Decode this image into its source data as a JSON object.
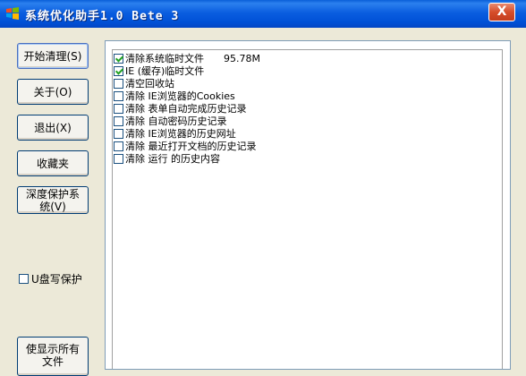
{
  "window": {
    "title": "系统优化助手1.0 Bete 3",
    "close_label": "X",
    "accent": "#0054e3"
  },
  "sidebar": {
    "buttons": [
      {
        "label": "开始清理(S)"
      },
      {
        "label": "关于(O)"
      },
      {
        "label": "退出(X)"
      },
      {
        "label": "收藏夹"
      },
      {
        "label": "深度保护系统(V)"
      },
      {
        "label": "使显示所有文件"
      }
    ],
    "vdisk": {
      "label": "U盘写保护",
      "checked": false
    }
  },
  "list": {
    "items": [
      {
        "label": "清除系统临时文件",
        "checked": true,
        "size": "95.78M"
      },
      {
        "label": "IE (缓存)临时文件",
        "checked": true
      },
      {
        "label": "清空回收站",
        "checked": false
      },
      {
        "label": "清除 IE浏览器的Cookies",
        "checked": false
      },
      {
        "label": "清除 表单自动完成历史记录",
        "checked": false
      },
      {
        "label": "清除 自动密码历史记录",
        "checked": false
      },
      {
        "label": "清除 IE浏览器的历史网址",
        "checked": false
      },
      {
        "label": "清除 最近打开文档的历史记录",
        "checked": false
      },
      {
        "label": "清除 运行 的历史内容",
        "checked": false
      }
    ]
  }
}
